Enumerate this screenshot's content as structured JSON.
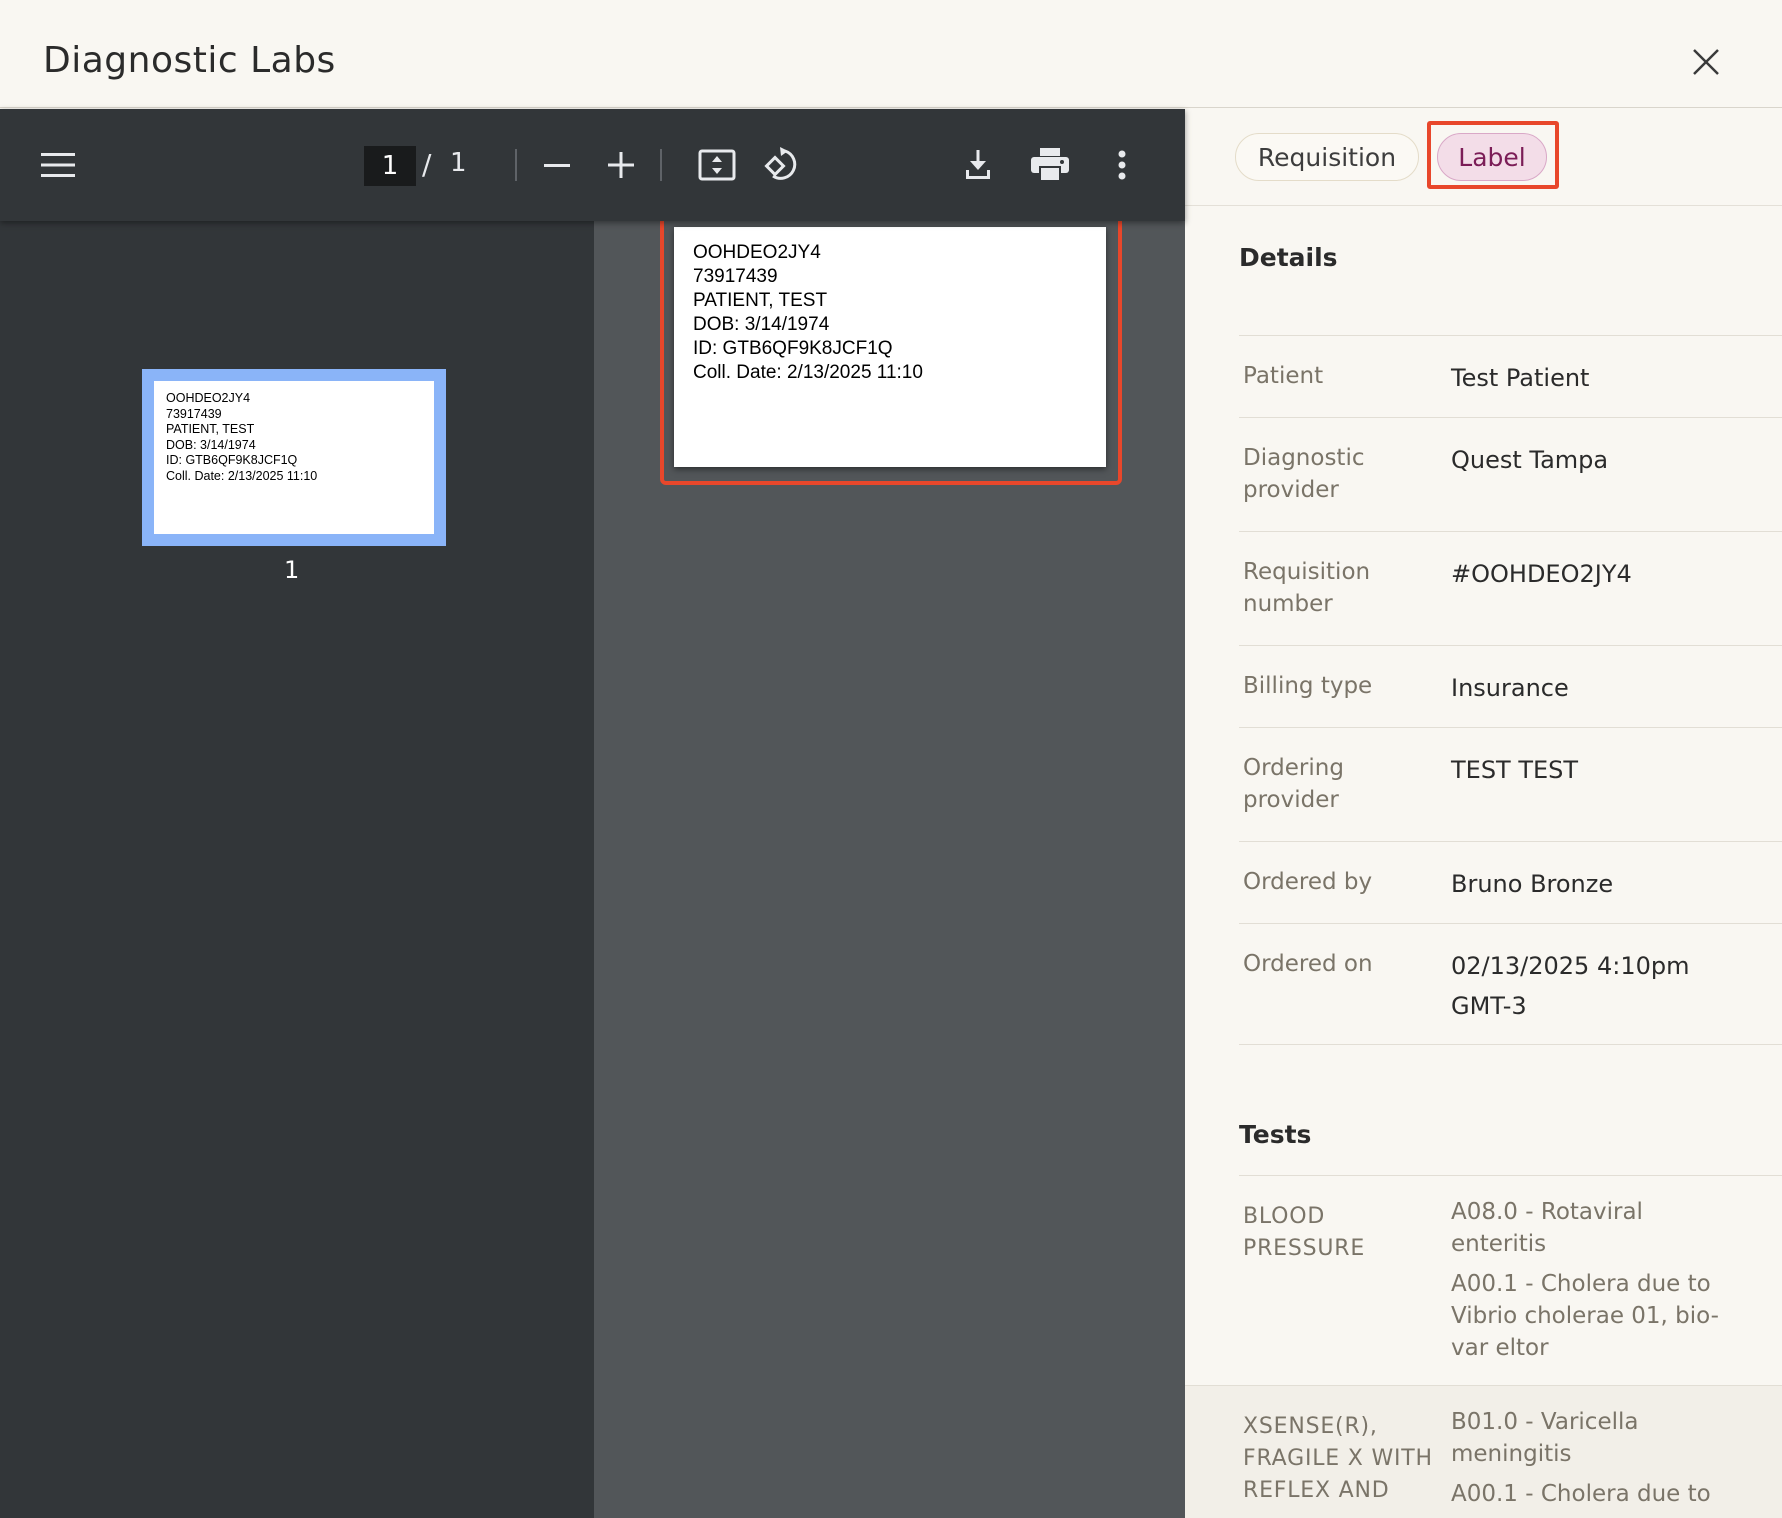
{
  "header": {
    "title": "Diagnostic Labs"
  },
  "pdf": {
    "current_page": "1",
    "separator": "/",
    "total_pages": "1",
    "thumbnail_number": "1",
    "label_lines": [
      "OOHDEO2JY4",
      "73917439",
      "PATIENT, TEST",
      "DOB: 3/14/1974",
      "ID: GTB6QF9K8JCF1Q",
      "Coll. Date: 2/13/2025 11:10"
    ]
  },
  "tabs": [
    {
      "label": "Requisition",
      "selected": false
    },
    {
      "label": "Label",
      "selected": true
    }
  ],
  "details": {
    "title": "Details",
    "rows": [
      {
        "key": "Patient",
        "value": "Test Patient"
      },
      {
        "key": "Diagnostic provider",
        "value": "Quest Tampa"
      },
      {
        "key": "Requisition number",
        "value": "#OOHDEO2JY4"
      },
      {
        "key": "Billing type",
        "value": "Insurance"
      },
      {
        "key": "Ordering provider",
        "value": "TEST TEST"
      },
      {
        "key": "Ordered by",
        "value": "Bruno Bronze"
      },
      {
        "key": "Ordered on",
        "value": "02/13/2025 4:10pm GMT-3"
      }
    ]
  },
  "tests": {
    "title": "Tests",
    "rows": [
      {
        "key": "BLOOD PRESSURE",
        "values": [
          "A08.0 - Rotaviral enteritis",
          "A00.1 - Cholera due to Vibrio cholerae 01, bio-var eltor"
        ]
      },
      {
        "key": "XSENSE(R), FRAGILE X WITH REFLEX AND",
        "values": [
          "B01.0 - Varicella meningitis",
          "A00.1 - Cholera due to"
        ]
      }
    ]
  }
}
